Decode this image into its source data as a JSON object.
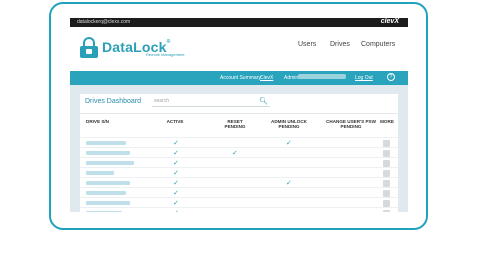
{
  "topbar": {
    "email": "datalockerq@clexx.com",
    "logo": "clevX"
  },
  "brand": {
    "name": "DataLock",
    "sup": "®",
    "sub": "Remote Management"
  },
  "nav": {
    "users": "Users",
    "drives": "Drives",
    "computers": "Computers"
  },
  "subbar": {
    "account_label": "Account Summary:",
    "account_link": "ClevX",
    "admin_label": "Admin:",
    "logout": "Log Out",
    "help": "?"
  },
  "panel": {
    "title": "Drives Dashboard",
    "search_placeholder": "search"
  },
  "table": {
    "headers": [
      "DRIVE S/N",
      "ACTIVE",
      "RESET PENDING",
      "ADMIN UNLOCK PENDING",
      "CHANGE USER'S PSW PENDING",
      "MORE"
    ],
    "rows": [
      {
        "active": true,
        "reset": false,
        "unlock": true
      },
      {
        "active": true,
        "reset": true,
        "unlock": false
      },
      {
        "active": true,
        "reset": false,
        "unlock": false
      },
      {
        "active": true,
        "reset": false,
        "unlock": false
      },
      {
        "active": true,
        "reset": false,
        "unlock": true
      },
      {
        "active": true,
        "reset": false,
        "unlock": false
      },
      {
        "active": true,
        "reset": false,
        "unlock": false
      },
      {
        "active": true,
        "reset": false,
        "unlock": false
      }
    ]
  },
  "colors": {
    "accent": "#2aa3bd",
    "check": "#2a9fb8"
  },
  "icons": {
    "brand": "padlock-usb-icon",
    "search": "search-icon",
    "check": "checkmark-icon"
  }
}
